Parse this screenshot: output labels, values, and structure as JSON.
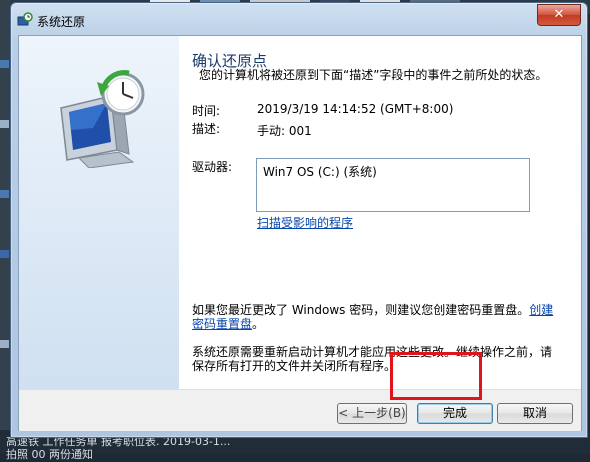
{
  "window": {
    "title": "系统还原",
    "close_glyph": "✕"
  },
  "content": {
    "heading": "确认还原点",
    "subtitle": "您的计算机将被还原到下面“描述”字段中的事件之前所处的状态。",
    "time_label": "时间:",
    "time_value": "2019/3/19 14:14:52 (GMT+8:00)",
    "desc_label": "描述:",
    "desc_value": "手动: 001",
    "drives_label": "驱动器:",
    "drives": [
      "Win7 OS (C:) (系统)"
    ],
    "scan_link": "扫描受影响的程序",
    "password_warning": "如果您最近更改了 Windows 密码，则建议您创建密码重置盘。",
    "password_link": "创建密码重置盘",
    "password_end": "。",
    "restart_note": "系统还原需要重新启动计算机才能应用这些更改。继续操作之前，请保存所有打开的文件并关闭所有程序。"
  },
  "buttons": {
    "back": "< 上一步(B)",
    "finish": "完成",
    "cancel": "取消"
  },
  "taskbar": {
    "line1": "高速铁    工作任务单   报考职位表.  2019-03-1...",
    "line2": "拍照 00      两份通知"
  },
  "icons": {
    "restore_art": "system-restore-computer-clock-icon",
    "title_icon": "system-restore-small-icon"
  },
  "colors": {
    "heading": "#1a3a6b",
    "link": "#0645ad",
    "highlight": "#e0141a"
  }
}
